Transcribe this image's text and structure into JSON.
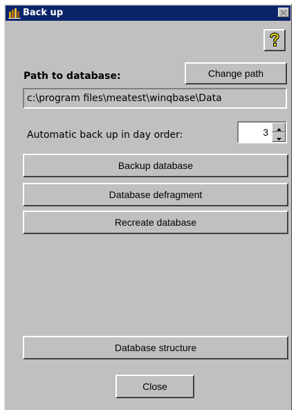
{
  "window": {
    "title": "Back up",
    "app_icon": "chart-bars-icon",
    "close_icon": "close-icon",
    "colors": {
      "titlebar": "#0a246a",
      "face": "#c0c0c0"
    }
  },
  "help": {
    "icon": "help-question-icon",
    "icon_color": "#f0e000"
  },
  "path_section": {
    "label": "Path to database:",
    "change_button": "Change path",
    "value": "c:\\program files\\meatest\\winqbase\\Data"
  },
  "auto_backup": {
    "label": "Automatic back up in day order:",
    "value": "3"
  },
  "actions": {
    "backup": "Backup database",
    "defragment": "Database defragment",
    "recreate": "Recreate database",
    "structure": "Database structure",
    "close": "Close"
  }
}
